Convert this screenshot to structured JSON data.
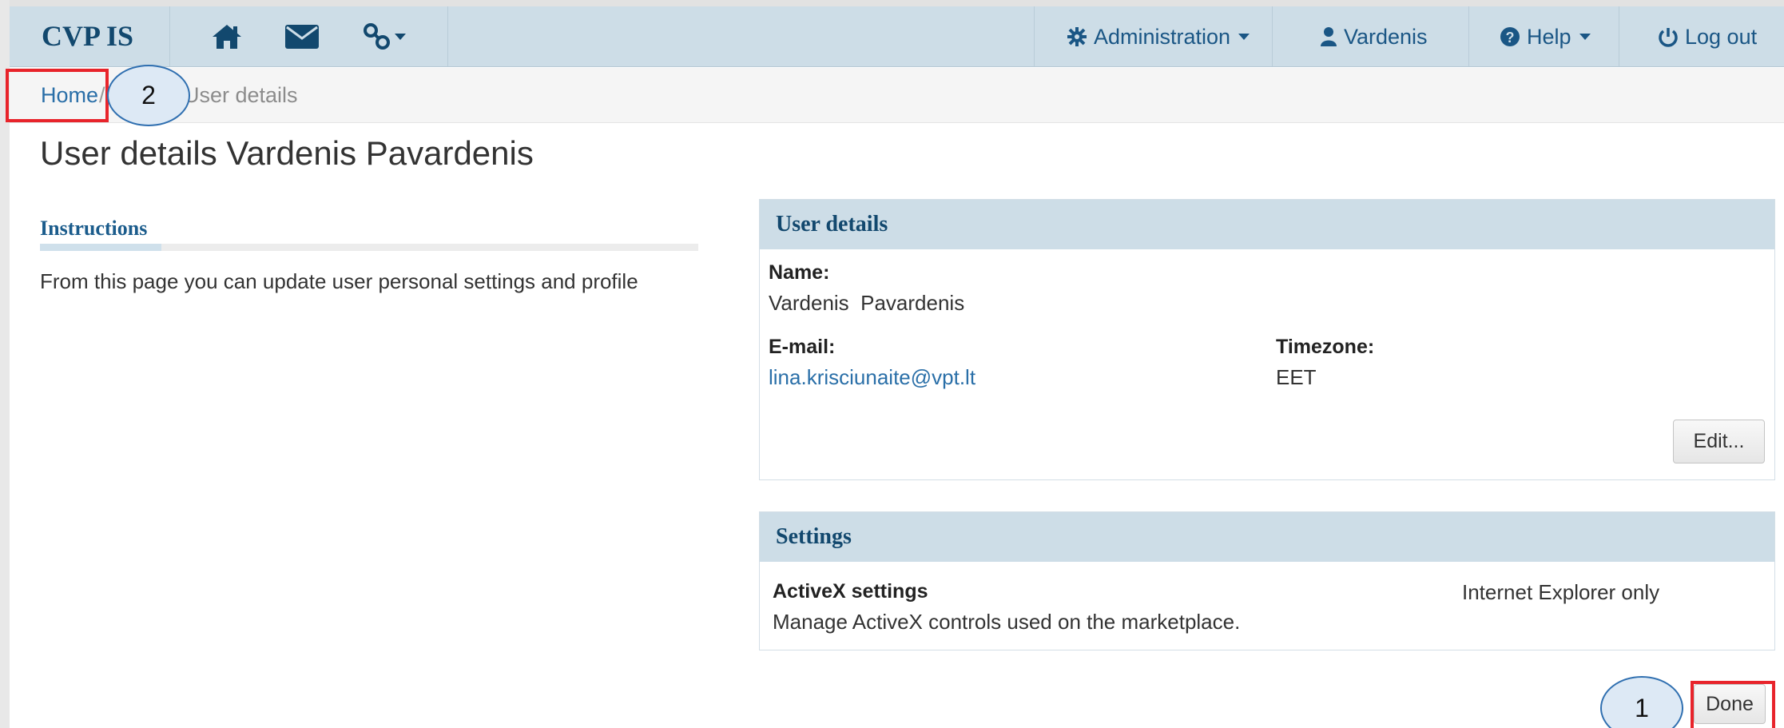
{
  "navbar": {
    "brand": "CVP IS",
    "icons": [
      "home-icon",
      "envelope-icon",
      "link-icon"
    ],
    "administration": "Administration",
    "user": "Vardenis",
    "help": "Help",
    "logout": "Log out"
  },
  "breadcrumb": {
    "home": "Home",
    "separator": "/",
    "current": "User details"
  },
  "page": {
    "title": "User details Vardenis Pavardenis"
  },
  "instructions": {
    "title": "Instructions",
    "text": "From this page you can update user personal settings and profile"
  },
  "user_details": {
    "title": "User details",
    "name_label": "Name:",
    "name_value": "Vardenis  Pavardenis",
    "email_label": "E-mail:",
    "email_value": "lina.krisciunaite@vpt.lt",
    "timezone_label": "Timezone:",
    "timezone_value": "EET",
    "edit_button": "Edit..."
  },
  "settings": {
    "title": "Settings",
    "activex_label": "ActiveX settings",
    "activex_desc": "Manage ActiveX controls used on the marketplace.",
    "activex_note": "Internet Explorer only"
  },
  "footer": {
    "done_button": "Done"
  },
  "annotations": {
    "circle_1": "1",
    "circle_2": "2"
  },
  "colors": {
    "navbar_bg": "#cddde7",
    "brand": "#12486e",
    "link": "#2a6fa8",
    "annotation_red": "#e8242b",
    "annotation_blue": "#2f6fb0"
  }
}
